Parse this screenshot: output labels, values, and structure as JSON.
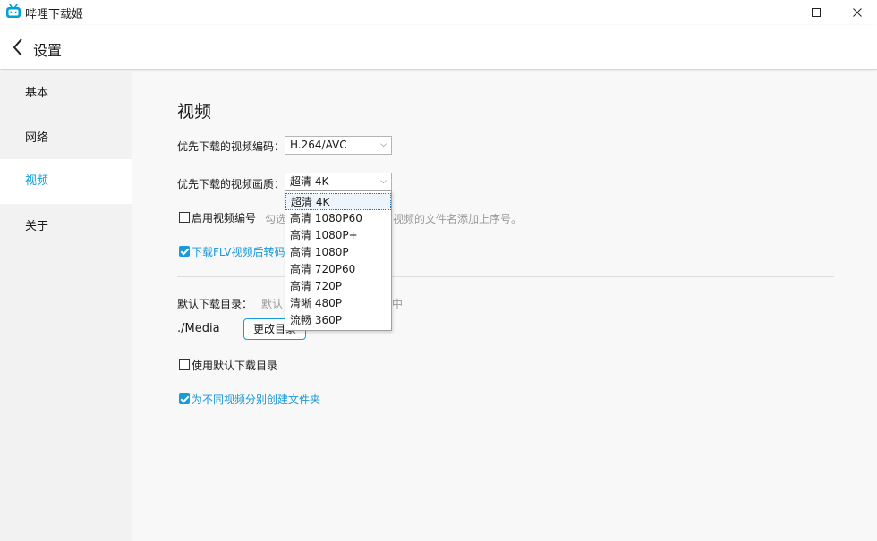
{
  "window": {
    "title": "哔哩下载姬"
  },
  "header": {
    "title": "设置"
  },
  "sidebar": {
    "items": [
      {
        "label": "基本",
        "active": false
      },
      {
        "label": "网络",
        "active": false
      },
      {
        "label": "视频",
        "active": true
      },
      {
        "label": "关于",
        "active": false
      }
    ]
  },
  "video": {
    "title": "视频",
    "codec_label": "优先下载的视频编码：",
    "codec_value": "H.264/AVC",
    "quality_label": "优先下载的视频画质：",
    "quality_value": "超清 4K",
    "quality_options": [
      "超清 4K",
      "高清 1080P60",
      "高清 1080P+",
      "高清 1080P",
      "高清 720P60",
      "高清 720P",
      "清晰 480P",
      "流畅 360P"
    ],
    "numbering_label": "启用视频编号",
    "numbering_checked": false,
    "numbering_hint_prefix": "勾选",
    "numbering_hint_suffix": "视频的文件名添加上序号。",
    "flv_label": "下载FLV视频后转码",
    "flv_checked": true,
    "dir_label": "默认下载目录：",
    "dir_hint_prefix": "默认",
    "dir_hint_suffix": "中",
    "dir_path": "./Media",
    "change_dir_button": "更改目录",
    "use_default_dir_label": "使用默认下载目录",
    "use_default_dir_checked": false,
    "create_folder_label": "为不同视频分别创建文件夹",
    "create_folder_checked": true
  },
  "colors": {
    "accent": "#1a9ad8",
    "active_nav": "#0d9dd7"
  },
  "icons": {
    "app": "bilibili-tv-icon",
    "back": "chevron-left-icon",
    "minimize": "minimize-icon",
    "maximize": "maximize-icon",
    "close": "close-icon",
    "caret": "caret-down-icon"
  }
}
